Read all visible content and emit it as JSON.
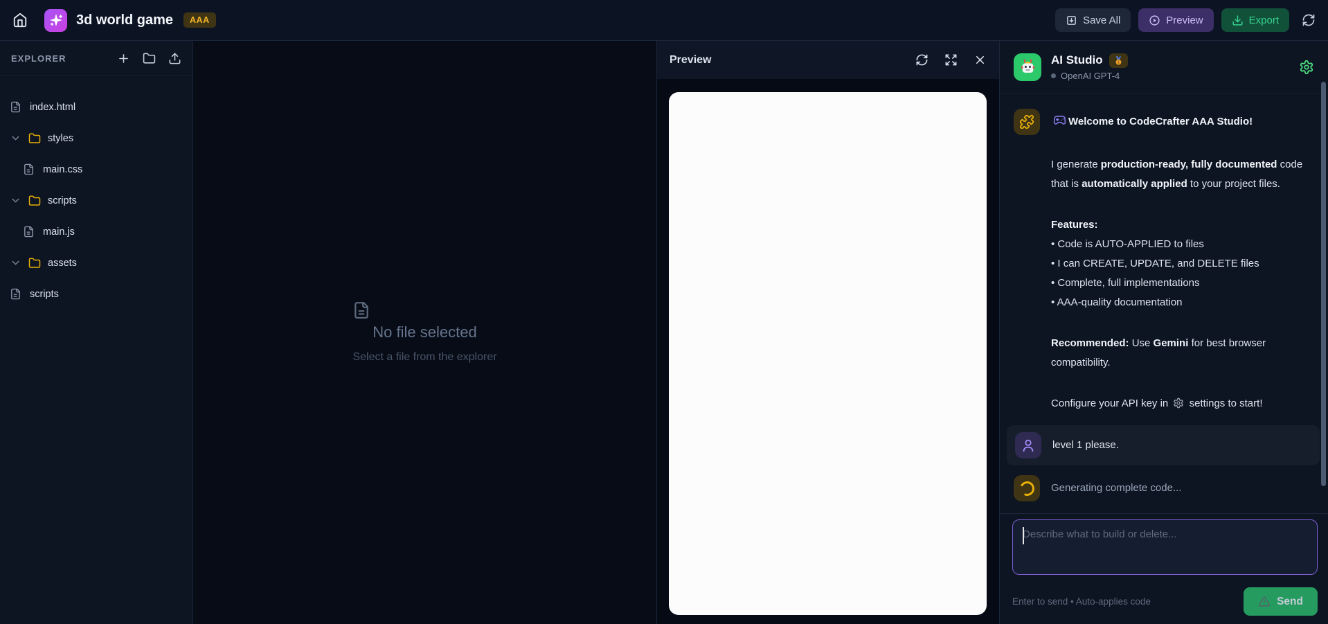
{
  "colors": {
    "accent_purple": "#8b5cf6",
    "folder_yellow": "#e7b008",
    "brand_green": "#2bc96a",
    "export_green": "#37d390"
  },
  "topbar": {
    "title": "3d world game",
    "badge": "AAA",
    "save_all_label": "Save All",
    "preview_label": "Preview",
    "export_label": "Export"
  },
  "explorer": {
    "header": "EXPLORER",
    "tree": [
      {
        "type": "file",
        "name": "index.html",
        "depth": 0
      },
      {
        "type": "folder",
        "name": "styles",
        "depth": 0
      },
      {
        "type": "file",
        "name": "main.css",
        "depth": 1
      },
      {
        "type": "folder",
        "name": "scripts",
        "depth": 0
      },
      {
        "type": "file",
        "name": "main.js",
        "depth": 1
      },
      {
        "type": "folder",
        "name": "assets",
        "depth": 0
      },
      {
        "type": "file",
        "name": "scripts",
        "depth": 0
      }
    ]
  },
  "editor_empty": {
    "title": "No file selected",
    "subtitle": "Select a file from the explorer"
  },
  "preview_panel": {
    "title": "Preview"
  },
  "chat": {
    "title": "AI Studio",
    "model": "OpenAI GPT-4",
    "messages": [
      {
        "kind": "assistant",
        "avatar": "puzzle-icon",
        "blocks": [
          [
            [
              {
                "icon": "gamepad-icon"
              },
              {
                "t": "Welcome to CodeCrafter AAA Studio!",
                "b": true
              }
            ]
          ],
          [
            [
              {
                "t": "I generate "
              },
              {
                "t": "production-ready, fully documented",
                "b": true
              },
              {
                "t": " code that is "
              },
              {
                "t": "automatically applied",
                "b": true
              },
              {
                "t": " to your project files."
              }
            ]
          ],
          [
            [
              {
                "t": "Features:",
                "b": true
              }
            ],
            [
              {
                "t": "• Code is AUTO-APPLIED to files"
              }
            ],
            [
              {
                "t": "• I can CREATE, UPDATE, and DELETE files"
              }
            ],
            [
              {
                "t": "• Complete, full implementations"
              }
            ],
            [
              {
                "t": "• AAA-quality documentation"
              }
            ]
          ],
          [
            [
              {
                "t": "Recommended:",
                "b": true
              },
              {
                "t": " Use "
              },
              {
                "t": "Gemini",
                "b": true
              },
              {
                "t": " for best browser compatibility."
              }
            ]
          ],
          [
            [
              {
                "t": "Configure your API key in "
              },
              {
                "icon": "gear-icon"
              },
              {
                "t": " settings to start!"
              }
            ]
          ]
        ]
      },
      {
        "kind": "user",
        "avatar": "user-icon",
        "blocks": [
          [
            [
              {
                "t": "level 1 please."
              }
            ]
          ]
        ]
      },
      {
        "kind": "loading",
        "avatar": "spinner-icon",
        "blocks": [
          [
            [
              {
                "t": "Generating complete code..."
              }
            ]
          ]
        ]
      }
    ],
    "input_placeholder": "Describe what to build or delete...",
    "footer_hint": "Enter to send • Auto-applies code",
    "send_label": "Send"
  }
}
